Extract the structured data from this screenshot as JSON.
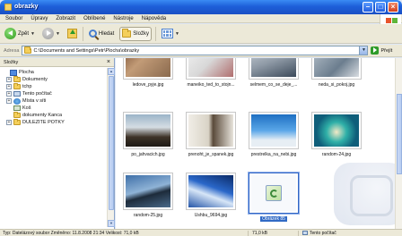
{
  "window": {
    "title": "obrazky"
  },
  "menu": [
    "Soubor",
    "Úpravy",
    "Zobrazit",
    "Oblíbené",
    "Nástroje",
    "Nápověda"
  ],
  "toolbar": {
    "back_label": "Zpět",
    "search_label": "Hledat",
    "folders_label": "Složky"
  },
  "address": {
    "label": "Adresa",
    "value": "C:\\Documents and Settings\\Petr\\Plocha\\obrazky",
    "go_label": "Přejít"
  },
  "tree": {
    "header": "Složky",
    "items": [
      {
        "label": "Plocha",
        "icon": "desktop-icon"
      },
      {
        "label": "Dokumenty",
        "icon": "folder-icon"
      },
      {
        "label": "tchp",
        "icon": "folder-icon"
      },
      {
        "label": "Tento počítač",
        "icon": "computer-icon"
      },
      {
        "label": "Místa v síti",
        "icon": "network-icon"
      },
      {
        "label": "Koš",
        "icon": "recycle-bin-icon"
      },
      {
        "label": "dokumenty Kanca",
        "icon": "folder-icon"
      },
      {
        "label": "DULEZITE POTKY",
        "icon": "folder-icon"
      }
    ]
  },
  "files": [
    {
      "name": "ledove_pyje.jpg"
    },
    {
      "name": "maneiko_ted_to_stojn..."
    },
    {
      "name": "selmem_co_se_deje_..."
    },
    {
      "name": "neda_si_pokoj.jpg"
    },
    {
      "name": "po_jahvacich.jpg"
    },
    {
      "name": "prenoht_je_spanek.jpg"
    },
    {
      "name": "prestrelka_na_nebi.jpg"
    },
    {
      "name": "random-24.jpg"
    },
    {
      "name": "random-25.jpg"
    },
    {
      "name": "Ushbu_9694.jpg"
    },
    {
      "name": "Obrázek 85"
    }
  ],
  "status": {
    "main": "Typ: Datelázový soubor Změněno: 11.8.2008 21:34 Velikost: 71,0 kB",
    "size": "71,0 kB",
    "zone": "Tento počítač"
  }
}
